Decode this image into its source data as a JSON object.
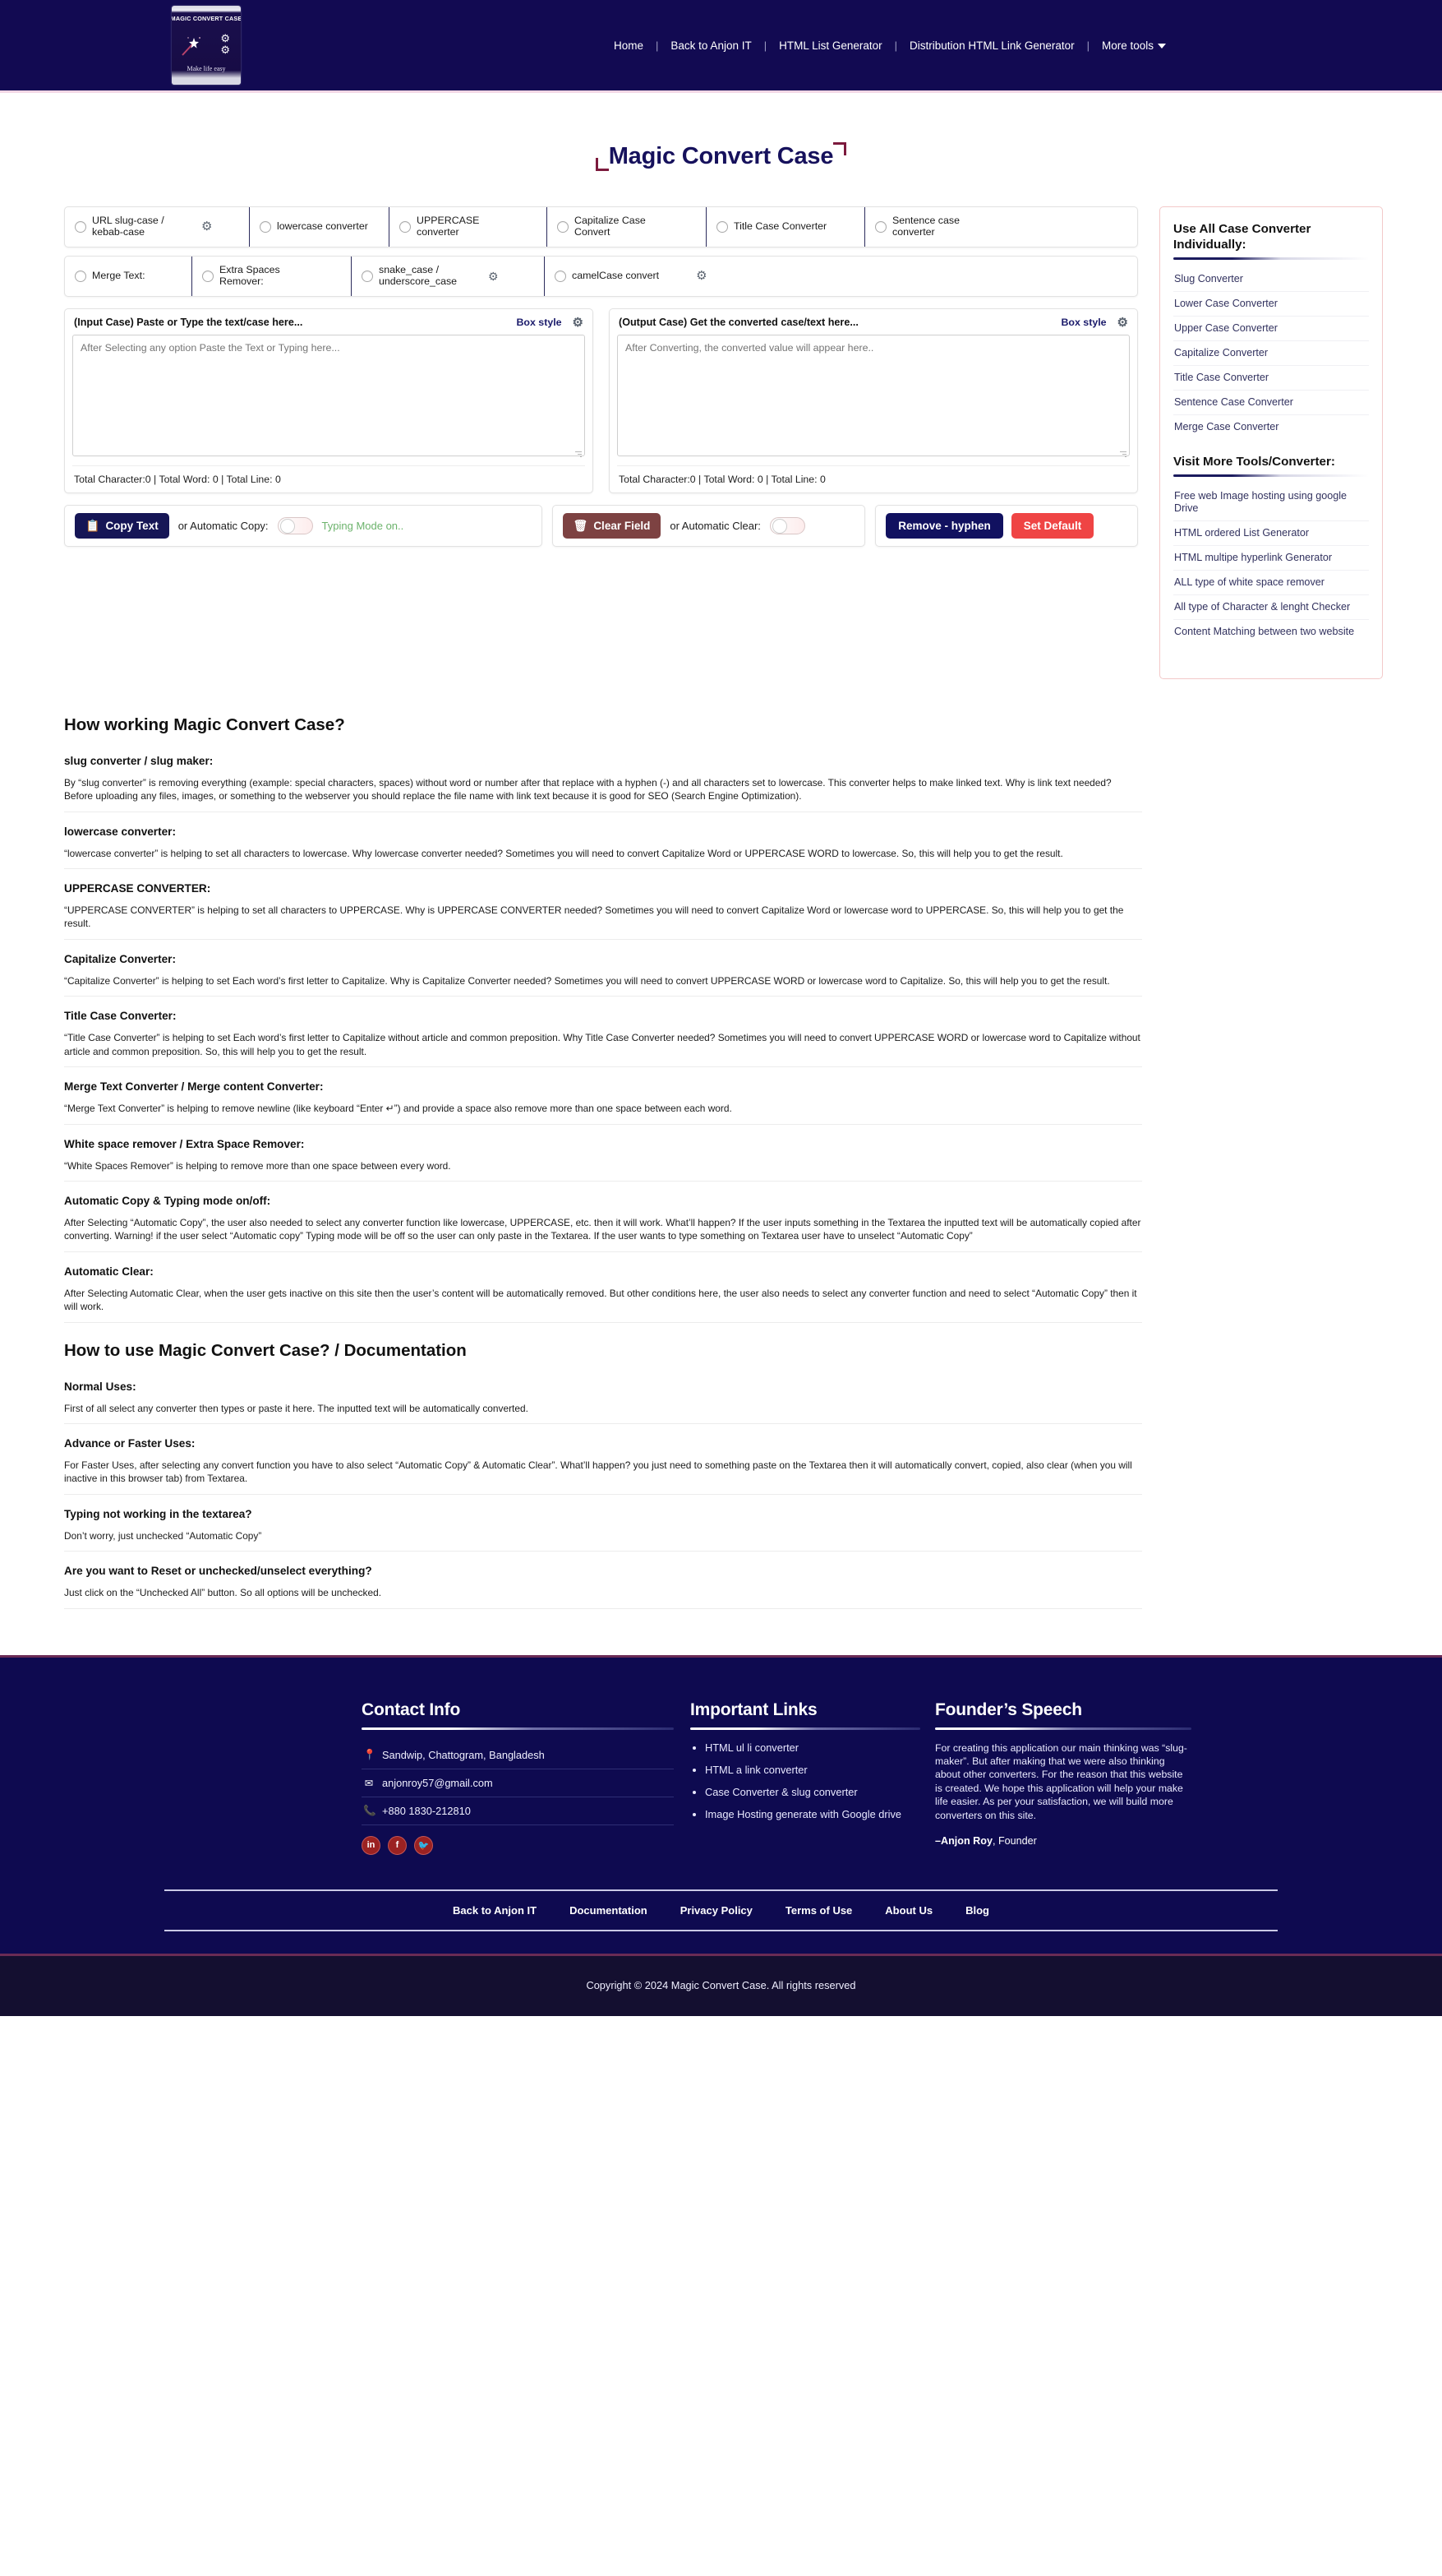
{
  "header": {
    "logo": {
      "title": "MAGIC CONVERT CASE",
      "tagline": "Make life easy"
    },
    "nav": [
      {
        "label": "Home"
      },
      {
        "label": "Back to Anjon IT"
      },
      {
        "label": "HTML List Generator"
      },
      {
        "label": "Distribution HTML Link Generator"
      },
      {
        "label": "More tools"
      }
    ]
  },
  "page": {
    "title": "Magic Convert Case"
  },
  "options_row1": [
    {
      "label": "URL slug-case / kebab-case",
      "gear": true
    },
    {
      "label": "lowercase converter",
      "gear": false
    },
    {
      "label": "UPPERCASE converter",
      "gear": false
    },
    {
      "label": "Capitalize Case Convert",
      "gear": false
    },
    {
      "label": "Title Case Converter",
      "gear": false
    },
    {
      "label": "Sentence case converter",
      "gear": false
    }
  ],
  "options_row2": [
    {
      "label": "Merge Text:",
      "gear": false
    },
    {
      "label": "Extra Spaces Remover:",
      "gear": false
    },
    {
      "label": "snake_case / underscore_case",
      "gear": true
    },
    {
      "label": "camelCase convert",
      "gear": true
    }
  ],
  "input_panel": {
    "heading": "(Input Case) Paste or Type the text/case here...",
    "box_style_label": "Box style",
    "placeholder": "After Selecting any option Paste the Text or Typing here...",
    "value": "",
    "counts": "Total Character:0 | Total Word: 0 | Total Line: 0"
  },
  "output_panel": {
    "heading": "(Output Case) Get the converted case/text here...",
    "box_style_label": "Box style",
    "placeholder": "After Converting, the converted value will appear here..",
    "value": "",
    "counts": "Total Character:0 | Total Word: 0 | Total Line: 0"
  },
  "actions": {
    "copy_button": "Copy Text",
    "auto_copy_label": "or Automatic Copy:",
    "typing_mode": "Typing Mode on..",
    "clear_button": "Clear Field",
    "auto_clear_label": "or Automatic Clear:",
    "remove_hyphen_button": "Remove - hyphen",
    "set_default_button": "Set Default"
  },
  "sidebar": {
    "heading1": "Use All Case Converter Individually:",
    "links1": [
      {
        "label": "Slug Converter"
      },
      {
        "label": "Lower Case Converter"
      },
      {
        "label": "Upper Case Converter"
      },
      {
        "label": "Capitalize Converter"
      },
      {
        "label": "Title Case Converter"
      },
      {
        "label": "Sentence Case Converter"
      },
      {
        "label": "Merge Case Converter"
      }
    ],
    "heading2": "Visit More Tools/Converter:",
    "links2": [
      {
        "label": "Free web Image hosting using google Drive"
      },
      {
        "label": "HTML ordered List Generator"
      },
      {
        "label": "HTML multipe hyperlink Generator"
      },
      {
        "label": "ALL type of white space remover"
      },
      {
        "label": "All type of Character & lenght Checker"
      },
      {
        "label": "Content Matching between two website"
      }
    ]
  },
  "article": {
    "h1_working": "How working Magic Convert Case?",
    "sections": [
      {
        "title": "slug converter / slug maker:",
        "body": "By “slug converter” is removing everything (example: special characters, spaces) without word or number after that replace with a hyphen (-) and all characters set to lowercase. This converter helps to make linked text. Why is link text needed? Before uploading any files, images, or something to the webserver you should replace the file name with link text because it is good for SEO (Search Engine Optimization)."
      },
      {
        "title": "lowercase converter:",
        "body": "“lowercase converter” is helping to set all characters to lowercase. Why lowercase converter needed? Sometimes you will need to convert Capitalize Word or UPPERCASE WORD to lowercase. So, this will help you to get the result."
      },
      {
        "title": "UPPERCASE CONVERTER:",
        "body": "“UPPERCASE CONVERTER” is helping to set all characters to UPPERCASE. Why is UPPERCASE CONVERTER needed? Sometimes you will need to convert Capitalize Word or lowercase word to UPPERCASE. So, this will help you to get the result."
      },
      {
        "title": "Capitalize Converter:",
        "body": "“Capitalize Converter” is helping to set Each word’s first letter to Capitalize. Why is Capitalize Converter needed? Sometimes you will need to convert UPPERCASE WORD or lowercase word to Capitalize. So, this will help you to get the result."
      },
      {
        "title": "Title Case Converter:",
        "body": "“Title Case Converter” is helping to set Each word’s first letter to Capitalize without article and common preposition. Why Title Case Converter needed? Sometimes you will need to convert UPPERCASE WORD or lowercase word to Capitalize without article and common preposition. So, this will help you to get the result."
      },
      {
        "title": "Merge Text Converter / Merge content Converter:",
        "body": "“Merge Text Converter” is helping to remove newline (like keyboard “Enter ↵”) and provide a space also remove more than one space between each word."
      },
      {
        "title": "White space remover / Extra Space Remover:",
        "body": "“White Spaces Remover” is helping to remove more than one space between every word."
      },
      {
        "title": "Automatic Copy & Typing mode on/off:",
        "body": "After Selecting “Automatic Copy”, the user also needed to select any converter function like lowercase, UPPERCASE, etc. then it will work. What’ll happen? If the user inputs something in the Textarea the inputted text will be automatically copied after converting. Warning! if the user select “Automatic copy” Typing mode will be off so the user can only paste in the Textarea. If the user wants to type something on Textarea user have to unselect “Automatic Copy”"
      },
      {
        "title": "Automatic Clear:",
        "body": "After Selecting Automatic Clear, when the user gets inactive on this site then the user’s content will be automatically removed. But other conditions here, the user also needs to select any converter function and need to select “Automatic Copy” then it will work."
      }
    ],
    "h1_howto": "How to use Magic Convert Case? / Documentation",
    "howto_sections": [
      {
        "title": "Normal Uses:",
        "body": "First of all select any converter then types or paste it here. The inputted text will be automatically converted."
      },
      {
        "title": "Advance or Faster Uses:",
        "body": "For Faster Uses, after selecting any convert function you have to also select “Automatic Copy” & Automatic Clear”. What’ll happen? you just need to something paste on the Textarea then it will automatically convert, copied, also clear (when you will inactive in this browser tab) from Textarea."
      },
      {
        "title": "Typing not working in the textarea?",
        "body": "Don’t worry, just unchecked “Automatic Copy”"
      },
      {
        "title": "Are you want to Reset or unchecked/unselect everything?",
        "body": "Just click on the “Unchecked All” button. So all options will be unchecked."
      }
    ]
  },
  "footer": {
    "contact": {
      "heading": "Contact Info",
      "address": "Sandwip, Chattogram, Bangladesh",
      "email": "anjonroy57@gmail.com",
      "phone": "+880 1830-212810",
      "socials": [
        {
          "name": "linkedin",
          "glyph": "in"
        },
        {
          "name": "facebook",
          "glyph": "f"
        },
        {
          "name": "twitter",
          "glyph": "🐦"
        }
      ]
    },
    "links": {
      "heading": "Important Links",
      "items": [
        {
          "label": "HTML ul li converter"
        },
        {
          "label": "HTML a link converter"
        },
        {
          "label": "Case Converter & slug converter"
        },
        {
          "label": "Image Hosting generate with Google drive"
        }
      ]
    },
    "speech": {
      "heading": "Founder’s Speech",
      "body": "For creating this application our main thinking was “slug-maker”. But after making that we were also thinking about other converters. For the reason that this website is created. We hope this application will help your make life easier. As per your satisfaction, we will build more converters on this site.",
      "sign_name": "–Anjon Roy",
      "sign_role": ", Founder"
    },
    "nav": [
      {
        "label": "Back to Anjon IT"
      },
      {
        "label": "Documentation"
      },
      {
        "label": "Privacy Policy"
      },
      {
        "label": "Terms of Use"
      },
      {
        "label": "About Us"
      },
      {
        "label": "Blog"
      }
    ],
    "copyright": "Copyright © 2024 Magic Convert Case. All rights reserved"
  },
  "colors": {
    "header_bg": "#120a52",
    "title": "#16115c",
    "accent_red": "#ef4444",
    "accent_dark": "#161656",
    "clear_btn": "#7d4242"
  }
}
